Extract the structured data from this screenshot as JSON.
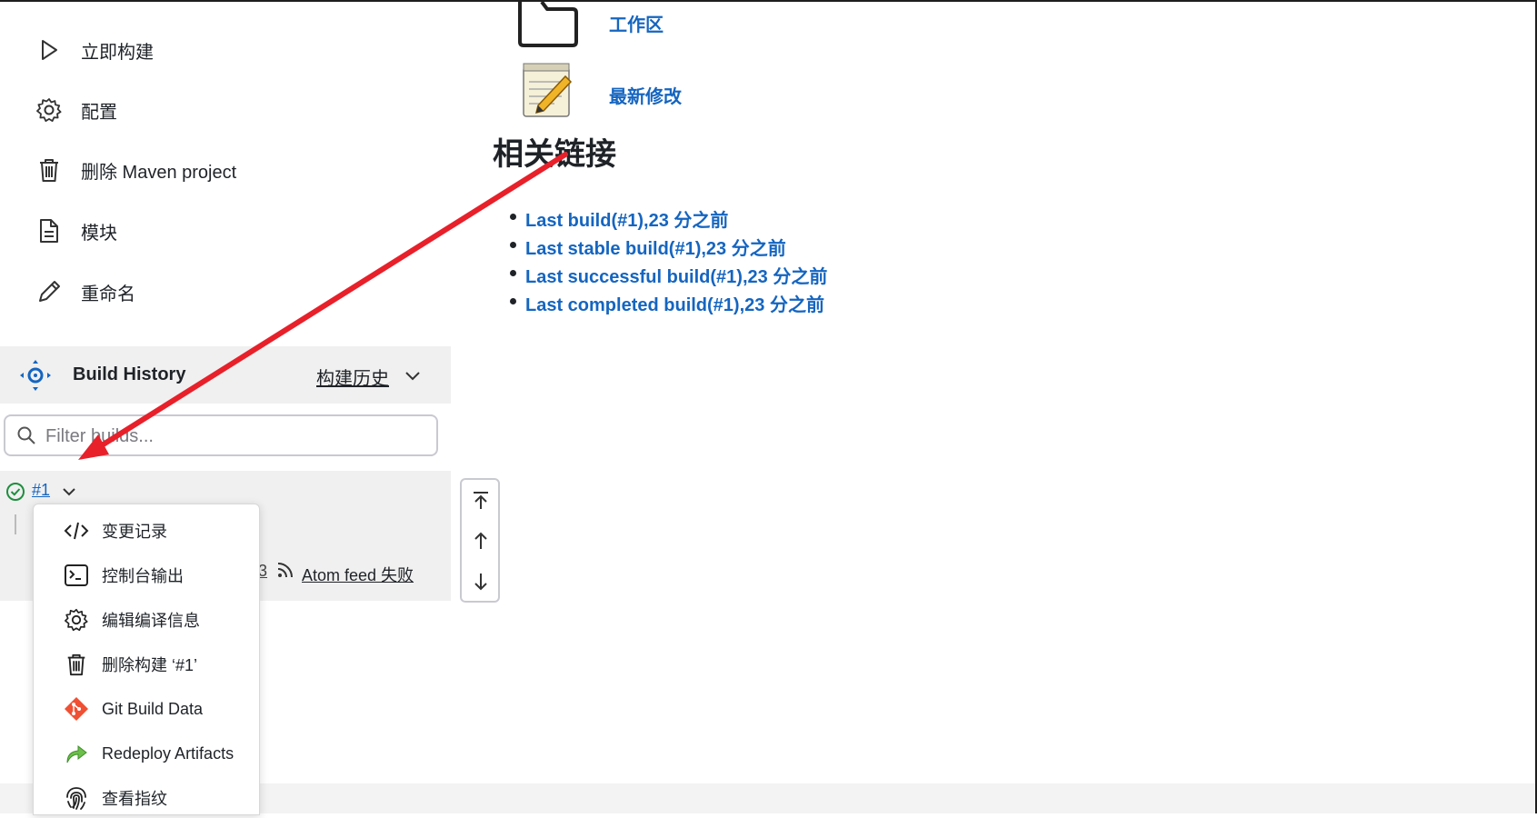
{
  "sidebar": {
    "tasks": [
      {
        "label": "立即构建",
        "icon": "play-icon"
      },
      {
        "label": "配置",
        "icon": "gear-icon"
      },
      {
        "label": "删除 Maven project",
        "icon": "trash-icon"
      },
      {
        "label": "模块",
        "icon": "document-icon"
      },
      {
        "label": "重命名",
        "icon": "pencil-icon"
      }
    ]
  },
  "build_history": {
    "title": "Build History",
    "trend_label": "构建历史",
    "filter_placeholder": "Filter builds...",
    "build": {
      "number": "#1",
      "status": "success"
    },
    "feed_fragment": "3",
    "atom_feed_fail": "Atom feed 失败"
  },
  "context_menu": {
    "items": [
      {
        "label": "变更记录",
        "icon": "code-icon"
      },
      {
        "label": "控制台输出",
        "icon": "terminal-icon"
      },
      {
        "label": "编辑编译信息",
        "icon": "gear-icon"
      },
      {
        "label": "删除构建 ‘#1’",
        "icon": "trash-icon"
      },
      {
        "label": "Git Build Data",
        "icon": "git-icon"
      },
      {
        "label": "Redeploy Artifacts",
        "icon": "redeploy-icon"
      },
      {
        "label": "查看指纹",
        "icon": "fingerprint-icon"
      }
    ]
  },
  "main": {
    "workspace_link": "工作区",
    "changes_link": "最新修改",
    "related_title": "相关链接",
    "related_links": [
      "Last build(#1),23 分之前",
      "Last stable build(#1),23 分之前",
      "Last successful build(#1),23 分之前",
      "Last completed build(#1),23 分之前"
    ]
  },
  "colors": {
    "link": "#1565c0",
    "success": "#1e8e3e",
    "annotation_arrow": "#e8202a",
    "panel_bg": "#f0f0f0"
  }
}
